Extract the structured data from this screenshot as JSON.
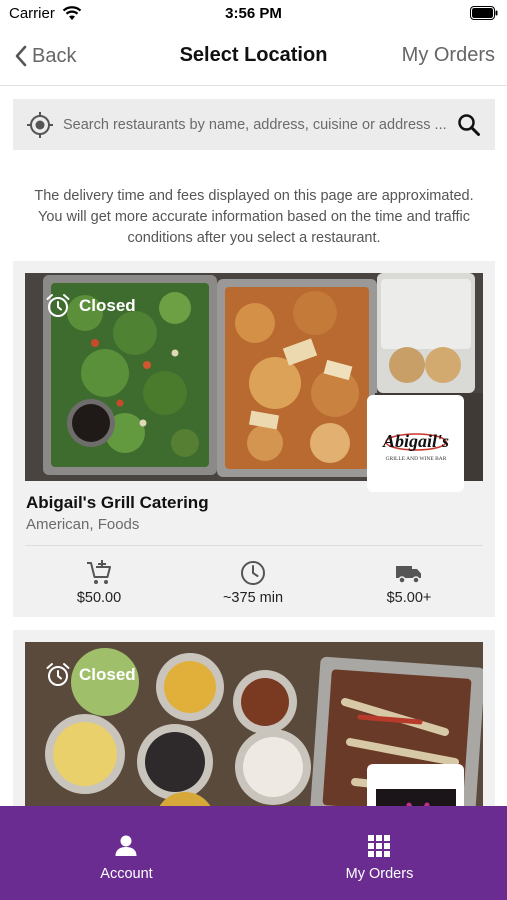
{
  "status_bar": {
    "carrier": "Carrier",
    "time": "3:56 PM"
  },
  "nav": {
    "back_label": "Back",
    "title": "Select Location",
    "orders_label": "My Orders"
  },
  "search": {
    "placeholder": "Search restaurants by name, address, cuisine or address ..."
  },
  "notice": "The delivery time and fees displayed on this page are approximated. You will get more accurate information based on the time and traffic conditions after you select a restaurant.",
  "restaurants": [
    {
      "status": "Closed",
      "name": "Abigail's Grill Catering",
      "cuisine": "American, Foods",
      "logo_text": "Abigail's",
      "logo_subtext": "GRILLE AND WINE BAR",
      "min_order": "$50.00",
      "delivery_time": "~375 min",
      "delivery_fee": "$5.00+"
    },
    {
      "status": "Closed"
    }
  ],
  "tab_bar": {
    "account_label": "Account",
    "orders_label": "My Orders"
  },
  "colors": {
    "tab_bar": "#6a2c91",
    "card_bg": "#f1f1f1",
    "search_bg": "#ececec"
  }
}
